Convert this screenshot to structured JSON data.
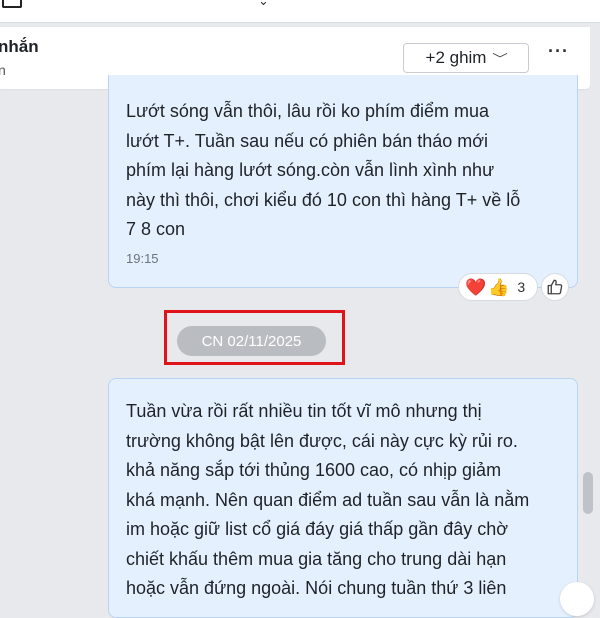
{
  "header": {
    "chat_name": "nhắn",
    "chat_sub": "n",
    "pin_button": "+2 ghim",
    "more": "···"
  },
  "messages": [
    {
      "lines": [
        "Lướt sóng vẫn thôi, lâu rồi ko phím điểm mua",
        "lướt T+. Tuần sau nếu có phiên bán tháo mới",
        "phím lại hàng lướt sóng.còn vẫn lình xình như",
        "này thì thôi, chơi kiểu đó 10 con thì hàng T+ về lỗ",
        "7 8 con"
      ],
      "time": "19:15",
      "reactions": {
        "heart": "❤️",
        "like": "👍",
        "count": "3"
      }
    },
    {
      "lines": [
        "Tuần vừa rồi rất nhiều tin tốt vĩ mô nhưng thị",
        "trường không bật lên được, cái này cực kỳ rủi ro.",
        "khả năng sắp tới thủng 1600 cao, có nhịp giảm",
        "khá mạnh. Nên quan điểm ad tuần sau vẫn là nằm",
        "im hoặc giữ list cổ giá đáy giá thấp gần đây chờ",
        "chiết khấu thêm mua gia tăng cho trung dài hạn",
        "hoặc vẫn đứng ngoài. Nói chung tuần thứ 3 liên"
      ]
    }
  ],
  "date_separator": "CN 02/11/2025",
  "colors": {
    "bubble_bg": "#e5f0ff",
    "bubble_border": "#b9d3f4",
    "highlight": "#e0131a",
    "date_pill": "#b9bcc1"
  }
}
